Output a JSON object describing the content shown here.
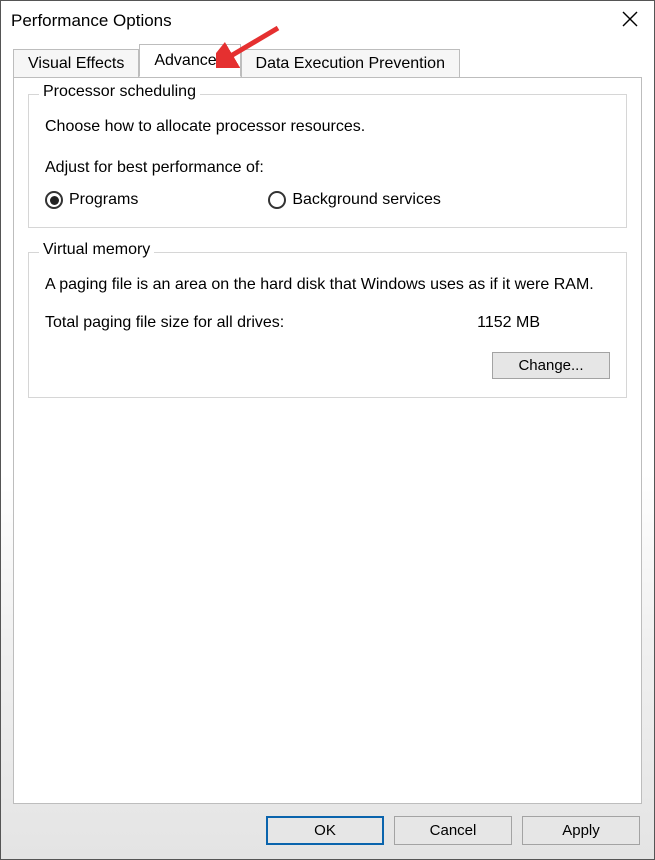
{
  "window": {
    "title": "Performance Options"
  },
  "tabs": [
    {
      "label": "Visual Effects"
    },
    {
      "label": "Advanced"
    },
    {
      "label": "Data Execution Prevention"
    }
  ],
  "processor": {
    "legend": "Processor scheduling",
    "description": "Choose how to allocate processor resources.",
    "subhead": "Adjust for best performance of:",
    "options": {
      "programs": "Programs",
      "background": "Background services"
    }
  },
  "virtual_memory": {
    "legend": "Virtual memory",
    "description": "A paging file is an area on the hard disk that Windows uses as if it were RAM.",
    "total_label": "Total paging file size for all drives:",
    "total_value": "1152 MB",
    "change_label": "Change..."
  },
  "footer": {
    "ok": "OK",
    "cancel": "Cancel",
    "apply": "Apply"
  }
}
